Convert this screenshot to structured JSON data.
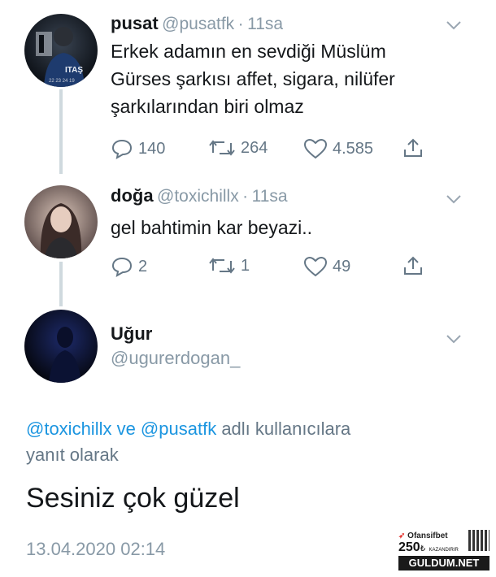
{
  "tweets": [
    {
      "name": "pusat",
      "handle": "@pusatfk",
      "sep": "·",
      "time": "11sa",
      "lines": [
        "Erkek adamın en sevdiği Müslüm",
        "Gürses şarkısı affet, sigara, nilüfer",
        "şarkılarından biri olmaz"
      ],
      "replies": "140",
      "retweets": "264",
      "likes": "4.585"
    },
    {
      "name": "doğa",
      "handle": "@toxichillx",
      "sep": "·",
      "time": "11sa",
      "lines": [
        "gel bahtimin kar beyazi.."
      ],
      "replies": "2",
      "retweets": "1",
      "likes": "49"
    }
  ],
  "main": {
    "name": "Uğur",
    "handle": "@ugurerdogan_",
    "reply_to_link": "@toxichillx ve @pusatfk",
    "reply_to_rest": " adlı kullanıcılara",
    "reply_to_line2": "yanıt olarak",
    "text": "Sesiniz çok güzel",
    "date": "13.04.2020 02:14"
  },
  "ad": {
    "brand": "Ofansifbet",
    "amount": "250",
    "currency": "₺",
    "tag": "KAZANDIRIR",
    "site": "GULDUM.NET"
  },
  "colors": {
    "link": "#1b95e0",
    "muted": "#657786",
    "line": "#cfd9de"
  },
  "icons": [
    "reply-icon",
    "retweet-icon",
    "like-icon",
    "share-icon",
    "chevron-down-icon"
  ]
}
